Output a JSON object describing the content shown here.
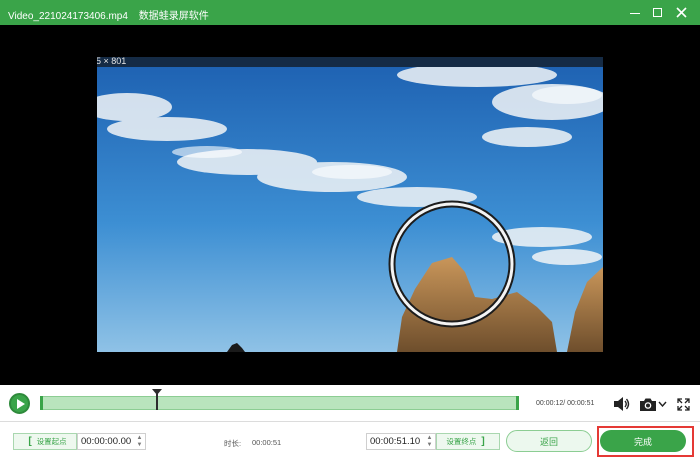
{
  "window": {
    "file_name": "Video_221024173406.mp4",
    "app_name": "数据蛙录屏软件"
  },
  "player": {
    "dimensions_text": "5 × 801",
    "time_readout": "00:00:12/ 00:00:51"
  },
  "trim": {
    "set_start_label": "设置起点",
    "start_time": "00:00:00.00",
    "duration_label": "时长:",
    "duration_value": "00:00:51",
    "end_time": "00:00:51.10",
    "set_end_label": "设置终点"
  },
  "actions": {
    "back_label": "返回",
    "done_label": "完成"
  },
  "icons": [
    "minimize-icon",
    "maximize-icon",
    "close-icon",
    "play-icon",
    "volume-icon",
    "camera-icon",
    "chevron-down-icon",
    "fullscreen-icon"
  ],
  "colors": {
    "accent": "#3aa449",
    "highlight": "#e53935"
  }
}
